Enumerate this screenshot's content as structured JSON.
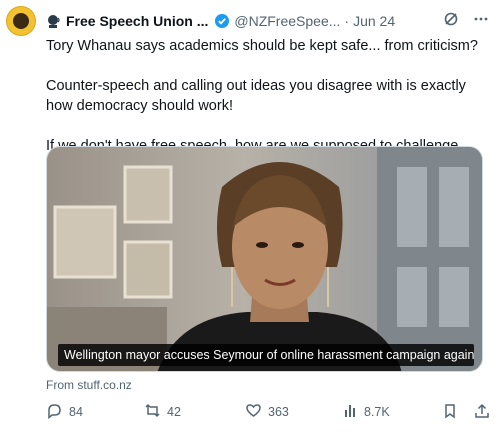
{
  "tweet": {
    "author_name": "Free Speech Union ...",
    "handle": "@NZFreeSpee...",
    "separator": "·",
    "date": "Jun 24",
    "paragraphs": [
      "Tory Whanau says academics should be kept safe... from criticism?",
      "Counter-speech and calling out ideas you disagree with is exactly how democracy should work!",
      "If we don't have free speech, how are we supposed to challenge ideas?"
    ],
    "media_caption": "Wellington mayor accuses Seymour of online harassment campaign against ac...",
    "source": "From stuff.co.nz"
  },
  "actions": {
    "replies": "84",
    "reposts": "42",
    "likes": "363",
    "views": "8.7K"
  },
  "colors": {
    "text": "#0f1419",
    "muted": "#536471",
    "verified": "#1d9bf0",
    "avatar": "#f2c230"
  },
  "icons": [
    "speaking-head-icon",
    "verified-badge-icon",
    "grok-icon",
    "more-icon",
    "reply-icon",
    "repost-icon",
    "like-icon",
    "views-icon",
    "bookmark-icon",
    "share-icon"
  ]
}
